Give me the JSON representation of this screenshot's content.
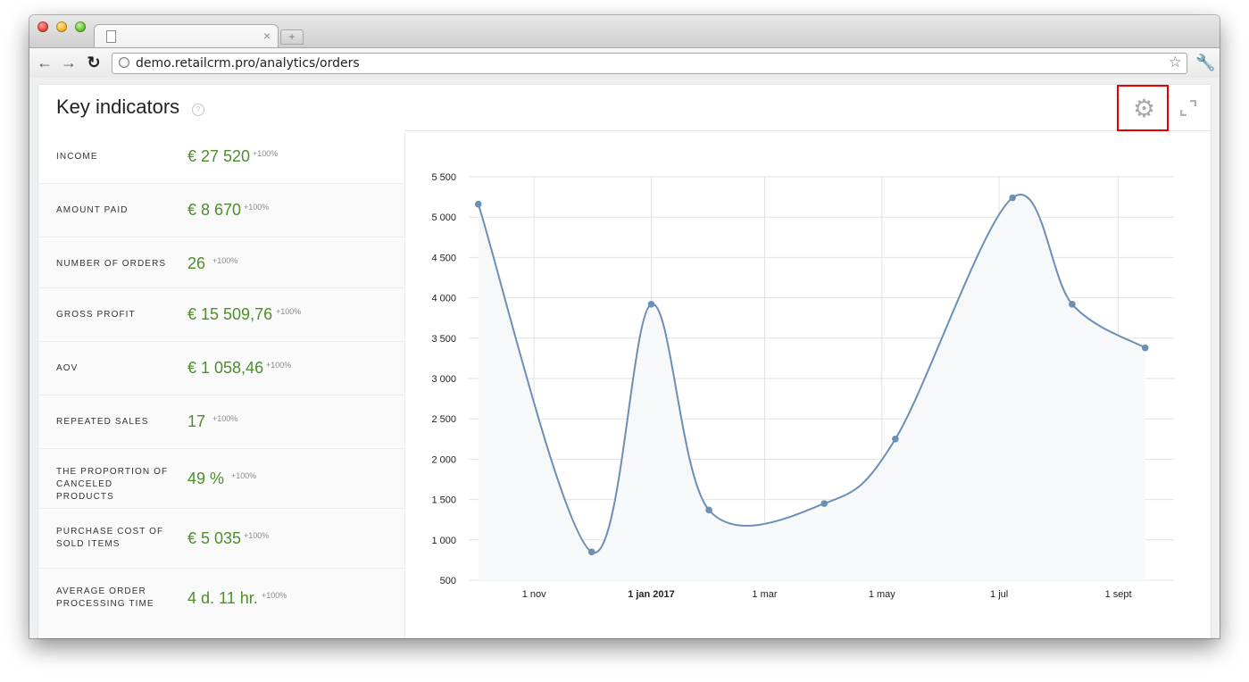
{
  "browser": {
    "url": "demo.retailcrm.pro/analytics/orders",
    "tab_close": "×",
    "newtab": "+"
  },
  "panel": {
    "title": "Key indicators",
    "help": "?"
  },
  "metrics": [
    {
      "label": "INCOME",
      "value": "€ 27 520",
      "delta": "+100%"
    },
    {
      "label": "AMOUNT PAID",
      "value": "€ 8 670",
      "delta": "+100%"
    },
    {
      "label": "NUMBER OF ORDERS",
      "value": "26",
      "delta": "+100%"
    },
    {
      "label": "GROSS PROFIT",
      "value": "€ 15 509,76",
      "delta": "+100%"
    },
    {
      "label": "AOV",
      "value": "€ 1 058,46",
      "delta": "+100%"
    },
    {
      "label": "REPEATED SALES",
      "value": "17",
      "delta": "+100%"
    },
    {
      "label": "THE PROPORTION OF CANCELED PRODUCTS",
      "value": "49 %",
      "delta": "+100%"
    },
    {
      "label": "PURCHASE COST OF SOLD ITEMS",
      "value": "€ 5 035",
      "delta": "+100%"
    },
    {
      "label": "AVERAGE ORDER PROCESSING TIME",
      "value": "4 d. 11 hr.",
      "delta": "+100%"
    }
  ],
  "chart_data": {
    "type": "area",
    "x": [
      "2016-10-03",
      "2016-12-01",
      "2017-01-01",
      "2017-01-31",
      "2017-04-01",
      "2017-05-08",
      "2017-07-08",
      "2017-08-08",
      "2017-09-15"
    ],
    "values": [
      5160,
      850,
      3920,
      1370,
      1450,
      2250,
      5240,
      3920,
      3380
    ],
    "ylim": [
      500,
      5500
    ],
    "yticks": [
      500,
      1000,
      1500,
      2000,
      2500,
      3000,
      3500,
      4000,
      4500,
      5000,
      5500
    ],
    "ytick_labels": [
      "500",
      "1 000",
      "1 500",
      "2 000",
      "2 500",
      "3 000",
      "3 500",
      "4 000",
      "4 500",
      "5 000",
      "5 500"
    ],
    "xtick_dates": [
      "2016-11-01",
      "2017-01-01",
      "2017-03-01",
      "2017-05-01",
      "2017-07-01",
      "2017-09-01"
    ],
    "xtick_labels": [
      "1 nov",
      "1 jan 2017",
      "1 mar",
      "1 may",
      "1 jul",
      "1 sept"
    ],
    "xtick_bold": [
      false,
      true,
      false,
      false,
      false,
      false
    ],
    "xlim": [
      "2016-09-28",
      "2017-09-30"
    ],
    "grid": true,
    "line_color": "#6b8fb5",
    "fill_color": "#f6f8fa"
  }
}
